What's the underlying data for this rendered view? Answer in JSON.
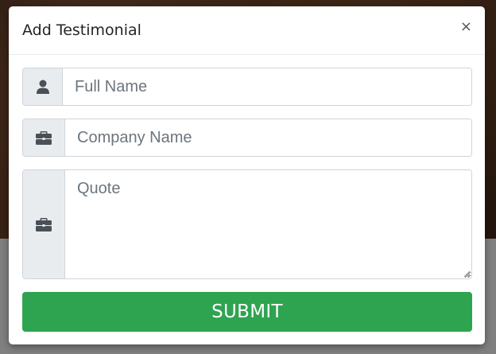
{
  "modal": {
    "title": "Add Testimonial",
    "close_label": "×"
  },
  "form": {
    "name_placeholder": "Full Name",
    "company_placeholder": "Company Name",
    "quote_placeholder": "Quote",
    "submit_label": "SUBMIT"
  },
  "icons": {
    "name_icon": "user-icon",
    "company_icon": "briefcase-icon",
    "quote_icon": "briefcase-icon"
  },
  "colors": {
    "submit_bg": "#2ea450",
    "addon_bg": "#e9ecef"
  }
}
